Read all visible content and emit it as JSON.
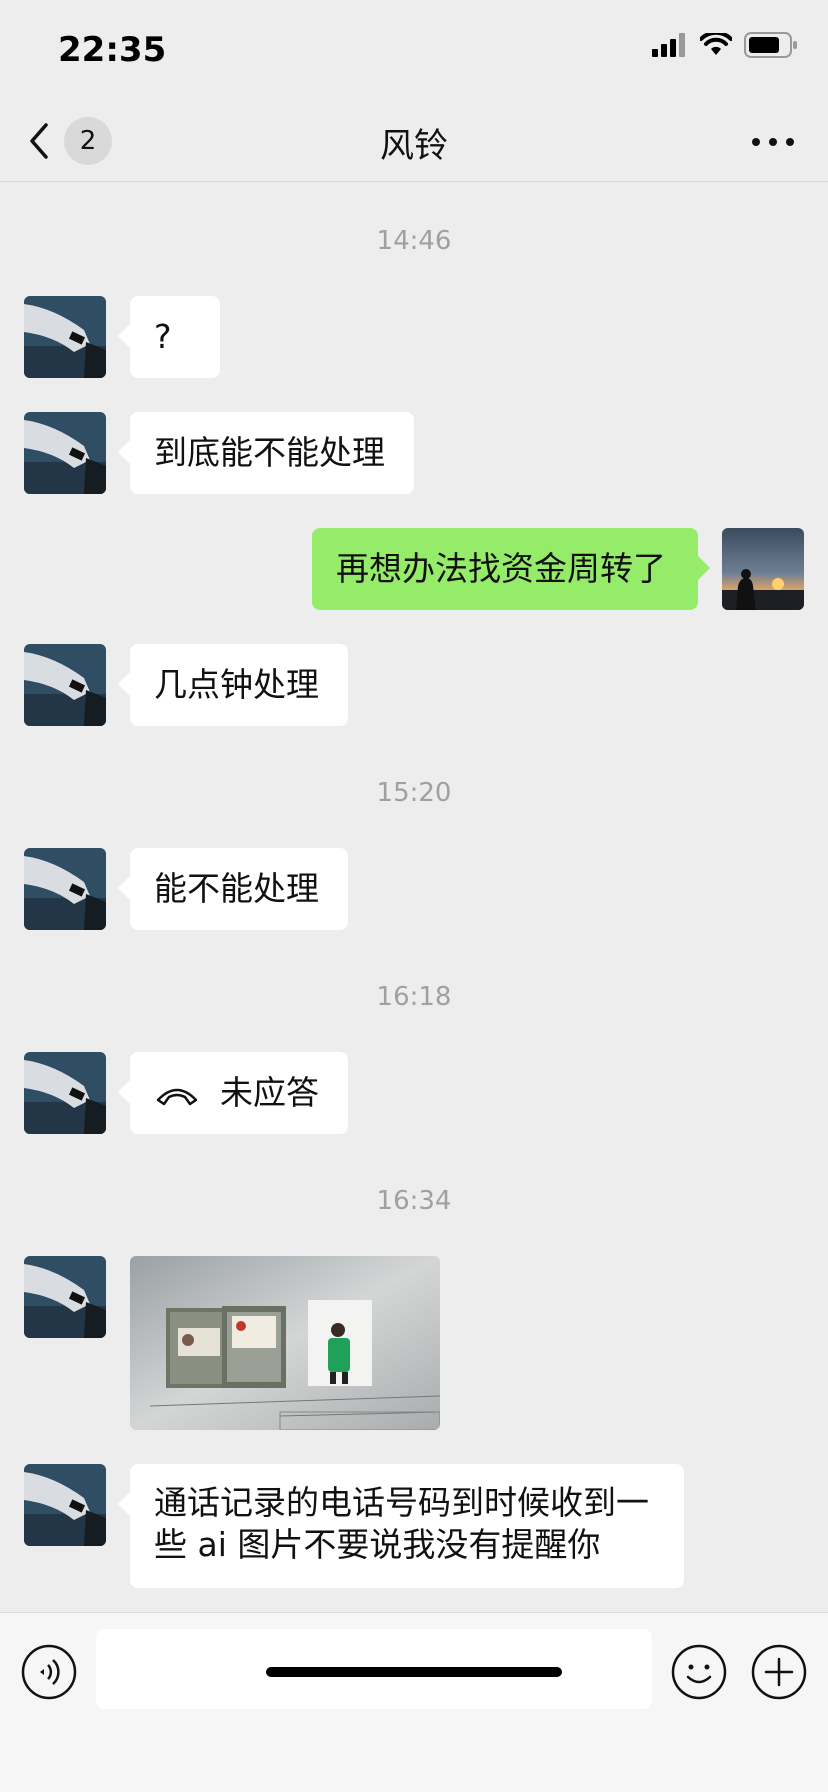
{
  "status": {
    "time": "22:35"
  },
  "header": {
    "title": "风铃",
    "unread_badge": "2"
  },
  "messages": [
    {
      "timestamp": "14:46"
    },
    {
      "side": "left",
      "text": "?"
    },
    {
      "side": "left",
      "text": "到底能不能处理"
    },
    {
      "side": "right",
      "text": "再想办法找资金周转了"
    },
    {
      "side": "left",
      "text": "几点钟处理"
    },
    {
      "timestamp": "15:20"
    },
    {
      "side": "left",
      "text": "能不能处理"
    },
    {
      "timestamp": "16:18"
    },
    {
      "side": "left",
      "type": "call",
      "text": "未应答",
      "icon": "phone-hangup-icon"
    },
    {
      "timestamp": "16:34"
    },
    {
      "side": "left",
      "type": "image"
    },
    {
      "side": "left",
      "text_line1": "通话记录的电话号码到时候收到一",
      "text_line2": "些 ai 图片不要说我没有提醒你"
    }
  ],
  "input": {
    "value": "",
    "placeholder": ""
  },
  "colors": {
    "background": "#ededed",
    "incoming_bubble": "#ffffff",
    "outgoing_bubble": "#95ec69"
  }
}
